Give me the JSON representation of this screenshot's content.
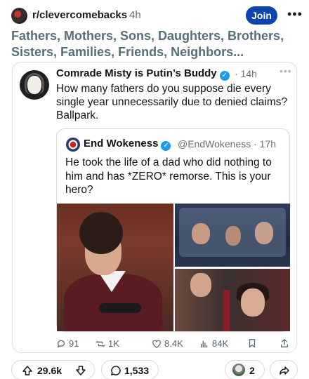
{
  "post": {
    "subreddit": "r/clevercomebacks",
    "age": "4h",
    "join_label": "Join",
    "more_label": "•••",
    "title": "Fathers, Mothers, Sons, Daughters, Brothers, Sisters, Families, Friends, Neighbors..."
  },
  "tweet": {
    "author": "Comrade Misty is Putin’s Buddy",
    "age": "· 14h",
    "more_label": "•••",
    "text": "How many fathers do you suppose die every single year unnecessarily due to denied claims? Ballpark.",
    "verified_icon": "check-badge-icon"
  },
  "quote": {
    "author": "End Wokeness",
    "handle": "@EndWokeness · 17h",
    "text": "He took the life of a dad who did nothing to him and has *ZERO* remorse. This is your hero?"
  },
  "tweet_actions": {
    "replies": "91",
    "retweets": "1K",
    "likes": "8.4K",
    "views": "84K"
  },
  "bottom_bar": {
    "votes": "29.6k",
    "comments": "1,533",
    "awards": "2"
  },
  "colors": {
    "join_button": "#0a45b0",
    "title_text": "#576f76",
    "verified_badge": "#1d9bf0"
  }
}
